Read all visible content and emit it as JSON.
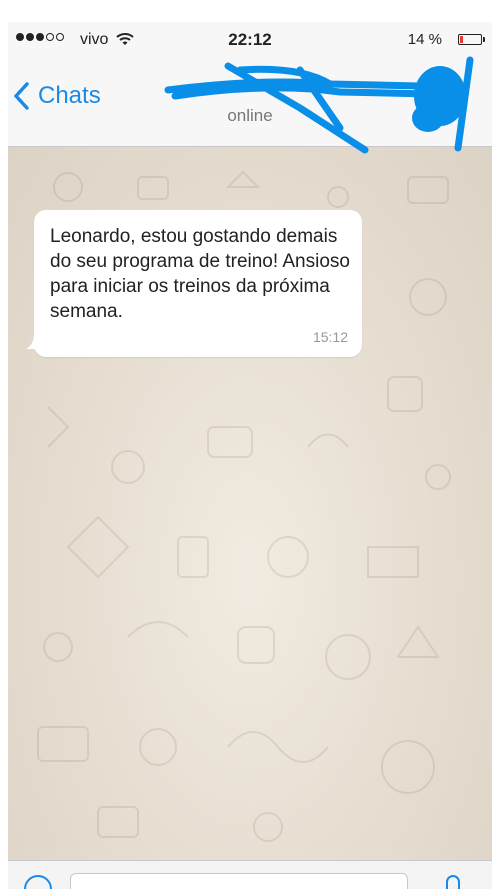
{
  "status_bar": {
    "carrier": "vivo",
    "time": "22:12",
    "battery_percent": "14 %",
    "battery_level": 0.14,
    "signal_strength": 3
  },
  "nav": {
    "back_label": "Chats",
    "contact_name": "",
    "contact_status": "online"
  },
  "messages": [
    {
      "text": "Leonardo, estou gostando demais do seu programa de treino! Ansioso para iniciar os treinos da próxima semana.",
      "time": "15:12",
      "direction": "incoming"
    }
  ],
  "input": {
    "placeholder": ""
  },
  "colors": {
    "accent": "#1a8ae6",
    "redaction": "#0a8fe8",
    "battery_low": "#e53935"
  },
  "icons": [
    "signal-icon",
    "wifi-icon",
    "battery-icon",
    "back-chevron-icon",
    "plus-icon",
    "microphone-icon"
  ]
}
